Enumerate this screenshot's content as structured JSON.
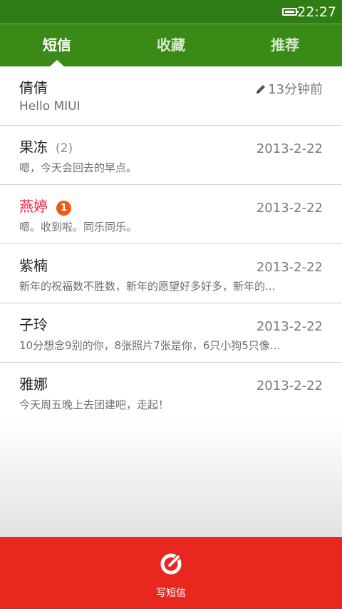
{
  "status_bar": {
    "time": "22:27"
  },
  "tabs": [
    {
      "label": "短信",
      "active": true
    },
    {
      "label": "收藏",
      "active": false
    },
    {
      "label": "推荐",
      "active": false
    }
  ],
  "conversations": [
    {
      "name": "倩倩",
      "count": "",
      "badge": "",
      "time": "13分钟前",
      "draft_icon": "pencil-icon",
      "preview": "Hello MIUI"
    },
    {
      "name": "果冻",
      "count": "(2)",
      "badge": "",
      "time": "2013-2-22",
      "preview": "嗯，今天会回去的早点。"
    },
    {
      "name": "燕婷",
      "count": "",
      "badge": "1",
      "time": "2013-2-22",
      "preview": "嗯。收到啦。同乐同乐。"
    },
    {
      "name": "紫楠",
      "count": "",
      "badge": "",
      "time": "2013-2-22",
      "preview": "新年的祝福数不胜数，新年的愿望好多好多，新年的..."
    },
    {
      "name": "子玲",
      "count": "",
      "badge": "",
      "time": "2013-2-22",
      "preview": "10分想念9别的你，8张照片7张是你，6只小狗5只像..."
    },
    {
      "name": "雅娜",
      "count": "",
      "badge": "",
      "time": "2013-2-22",
      "preview": "今天周五晚上去团建吧，走起！"
    }
  ],
  "compose": {
    "label": "写短信",
    "icon": "compose-icon"
  },
  "colors": {
    "status_bar": "#2f7d14",
    "tab_bar": "#3a8a18",
    "unread_name": "#e8213a",
    "badge": "#ef5b10",
    "compose_bar": "#e8271f"
  }
}
